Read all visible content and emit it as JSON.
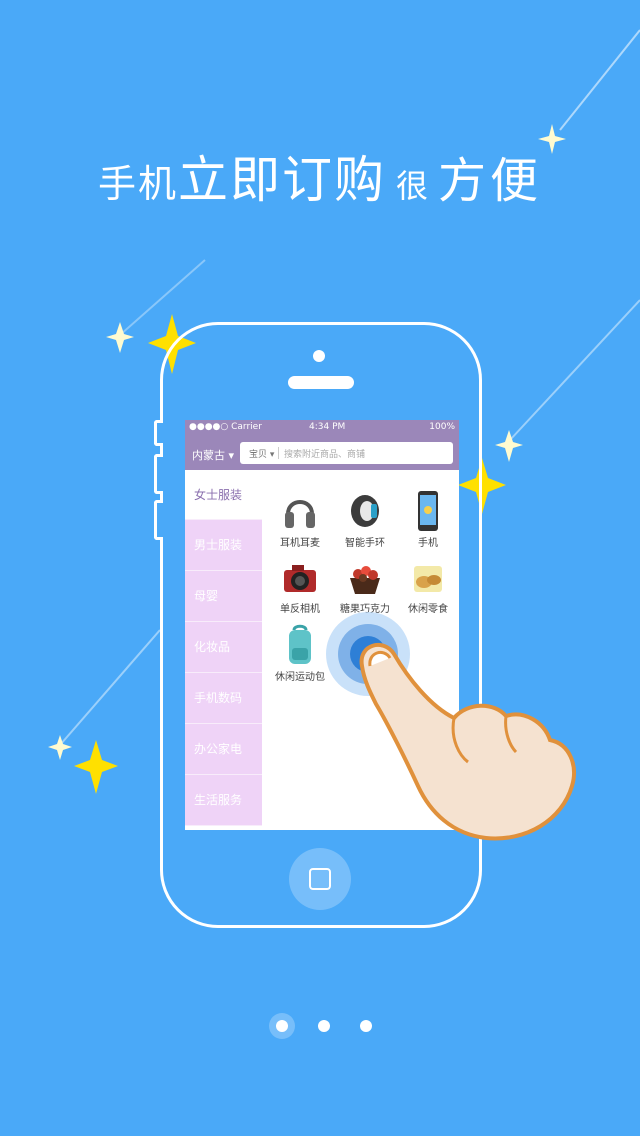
{
  "headline": {
    "part1": "手机",
    "part2": "立即订购",
    "part3": "很",
    "part4": "方便"
  },
  "status_bar": {
    "carrier": "●●●●○ Carrier",
    "time": "4:34 PM",
    "battery": "100%"
  },
  "nav": {
    "region": "内蒙古",
    "search_category": "宝贝",
    "search_placeholder": "搜索附近商品、商铺"
  },
  "sidebar": {
    "items": [
      {
        "label": "女士服装",
        "active": true
      },
      {
        "label": "男士服装",
        "active": false
      },
      {
        "label": "母婴",
        "active": false
      },
      {
        "label": "化妆品",
        "active": false
      },
      {
        "label": "手机数码",
        "active": false
      },
      {
        "label": "办公家电",
        "active": false
      },
      {
        "label": "生活服务",
        "active": false
      }
    ]
  },
  "grid": {
    "items": [
      {
        "label": "耳机耳麦",
        "icon": "headphones-icon"
      },
      {
        "label": "智能手环",
        "icon": "smart-band-icon"
      },
      {
        "label": "手机",
        "icon": "phone-icon"
      },
      {
        "label": "单反相机",
        "icon": "camera-icon"
      },
      {
        "label": "糖果巧克力",
        "icon": "chocolate-icon"
      },
      {
        "label": "休闲零食",
        "icon": "snack-icon"
      },
      {
        "label": "休闲运动包",
        "icon": "backpack-icon"
      }
    ]
  },
  "pager": {
    "count": 3,
    "active_index": 0
  },
  "colors": {
    "background": "#4aa9f8",
    "purple_bar": "#9b87b9",
    "sidebar_pink": "#efd3f7",
    "sparkle_yellow": "#ffe000"
  }
}
